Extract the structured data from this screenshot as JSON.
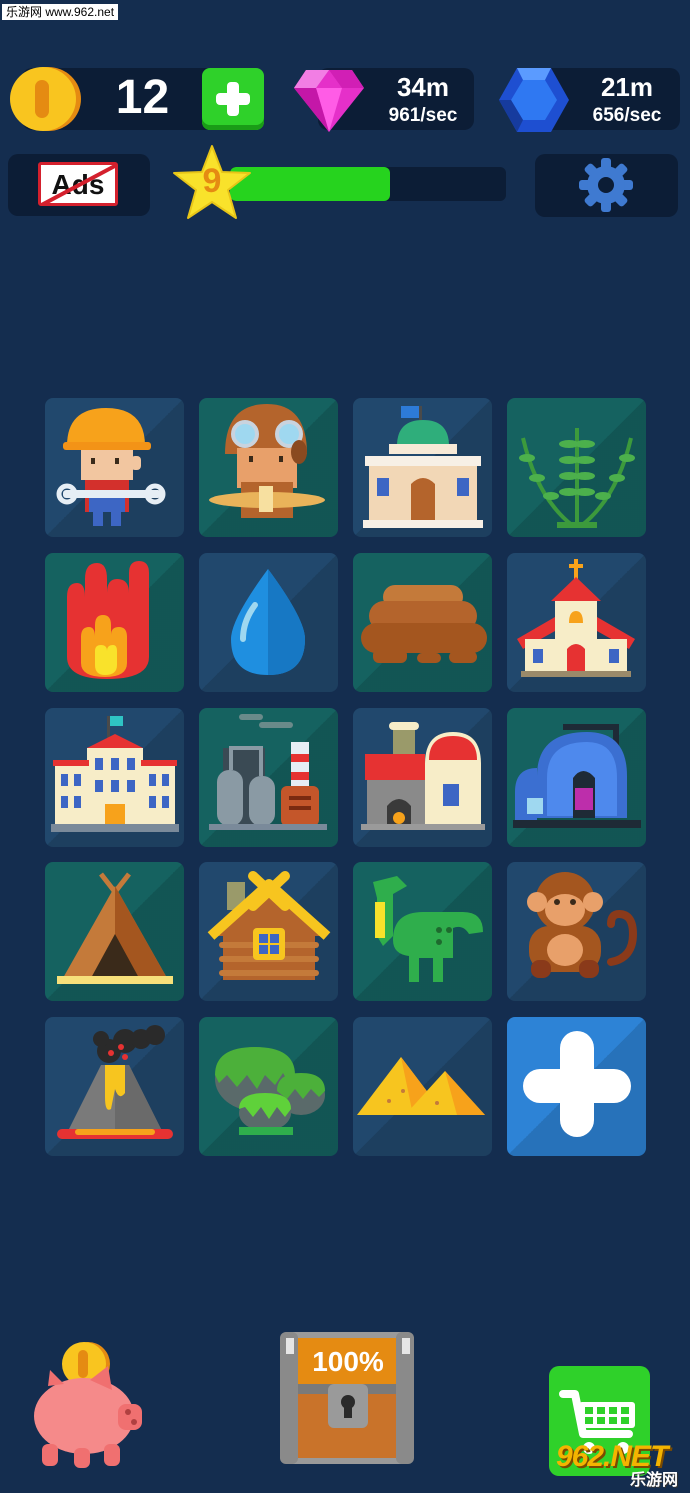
{
  "watermark": {
    "top": "乐游网 www.962.net",
    "bottom_logo": "962.NET",
    "bottom_sub": "乐游网"
  },
  "resources": {
    "coins": {
      "value": "12",
      "icon": "gold-coin-icon",
      "add_icon": "plus-icon"
    },
    "gems": {
      "value": "34m",
      "rate": "961/sec",
      "icon": "pink-gem-icon"
    },
    "sapphires": {
      "value": "21m",
      "rate": "656/sec",
      "icon": "blue-gem-icon"
    }
  },
  "ads": {
    "label": "Ads",
    "icon": "no-ads-icon"
  },
  "level": {
    "number": "9",
    "progress": 0.58,
    "icon": "star-icon"
  },
  "settings": {
    "icon": "gear-icon"
  },
  "grid": [
    "construction-worker",
    "aviator",
    "museum",
    "fern",
    "fire",
    "water-drop",
    "mud",
    "church",
    "university",
    "factory",
    "forge",
    "igloo-lab",
    "teepee",
    "log-cabin",
    "dinosaur",
    "monkey",
    "volcano",
    "moss-rocks",
    "sand-dunes",
    "add-element"
  ],
  "chest": {
    "label": "100%",
    "icon": "treasure-chest-icon"
  },
  "piggy": {
    "icon": "piggy-bank-icon"
  },
  "shop": {
    "icon": "shopping-cart-icon"
  },
  "colors": {
    "background": "#142d4f",
    "panel": "#0c1d36",
    "tile_blue": "#21486d",
    "tile_teal": "#156260",
    "green": "#2fd12a",
    "add_tile": "#2d83d6"
  }
}
